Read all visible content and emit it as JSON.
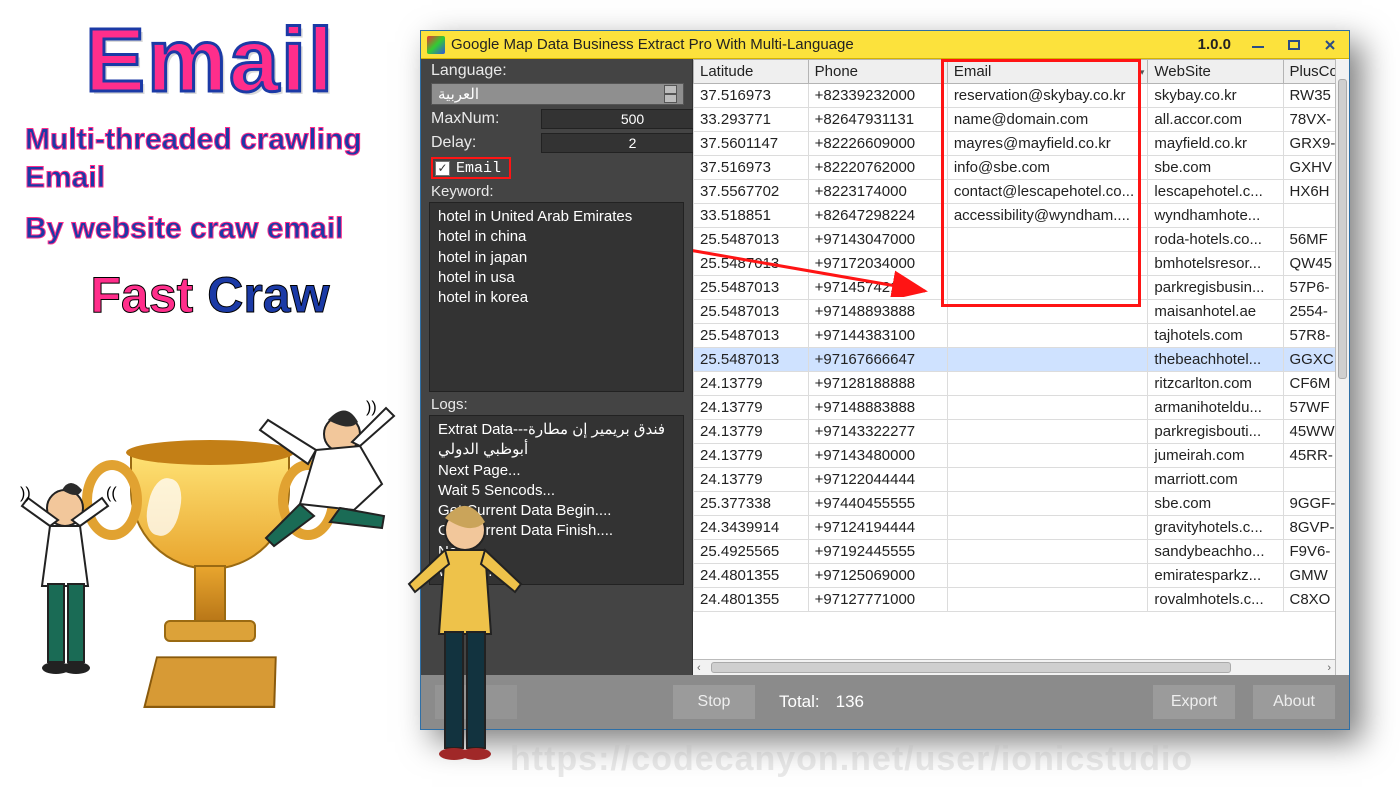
{
  "promo": {
    "headline": "Email",
    "line1": "Multi-threaded crawling Email",
    "line2": "By website craw email",
    "fast1": "Fast",
    "fast2": "Craw"
  },
  "watermark": "https://codecanyon.net/user/ionicstudio",
  "window": {
    "title": "Google Map Data Business Extract Pro With Multi-Language",
    "version": "1.0.0"
  },
  "sidebar": {
    "language_label": "Language:",
    "language_value": "العربية",
    "maxnum_label": "MaxNum:",
    "maxnum_value": "500",
    "delay_label": "Delay:",
    "delay_value": "2",
    "email_checkbox_label": "Email",
    "email_checked": true,
    "keyword_label": "Keyword:",
    "keywords": [
      "hotel in United Arab Emirates",
      "hotel in china",
      "hotel in japan",
      "hotel in usa",
      "hotel in korea"
    ],
    "logs_label": "Logs:",
    "logs": [
      "Extrat Data---فندق بريمير إن مطارة أبوظبي الدولي",
      "Next Page...",
      "Wait 5 Sencods...",
      "Get Current Data Begin....",
      "Get Current Data Finish....",
      "Next ...",
      "Wa...     s...",
      "Fini..."
    ]
  },
  "table": {
    "headers": {
      "lat": "Latitude",
      "phone": "Phone",
      "email": "Email",
      "web": "WebSite",
      "plus": "PlusCo"
    },
    "selected_index": 12,
    "rows": [
      {
        "lat": "37.516973",
        "phone": "+82339232000",
        "email": "reservation@skybay.co.kr",
        "web": "skybay.co.kr",
        "plus": "RW35"
      },
      {
        "lat": "33.293771",
        "phone": "+82647931131",
        "email": "name@domain.com",
        "web": "all.accor.com",
        "plus": "78VX-"
      },
      {
        "lat": "37.5601147",
        "phone": "+82226609000",
        "email": "mayres@mayfield.co.kr",
        "web": "mayfield.co.kr",
        "plus": "GRX9-"
      },
      {
        "lat": "37.516973",
        "phone": "+82220762000",
        "email": "info@sbe.com",
        "web": "sbe.com",
        "plus": "GXHV"
      },
      {
        "lat": "37.5567702",
        "phone": "+8223174000",
        "email": "contact@lescapehotel.co...",
        "web": "lescapehotel.c...",
        "plus": "HX6H"
      },
      {
        "lat": "33.518851",
        "phone": "+82647298224",
        "email": "accessibility@wyndham....",
        "web": "wyndhamhote...",
        "plus": ""
      },
      {
        "lat": "25.5487013",
        "phone": "+97143047000",
        "email": "",
        "web": "roda-hotels.co...",
        "plus": "56MF"
      },
      {
        "lat": "25.5487013",
        "phone": "+97172034000",
        "email": "",
        "web": "bmhotelsresor...",
        "plus": "QW45"
      },
      {
        "lat": "25.5487013",
        "phone": "+97145742100",
        "email": "",
        "web": "parkregisbusin...",
        "plus": "57P6-"
      },
      {
        "lat": "25.5487013",
        "phone": "+97148893888",
        "email": "",
        "web": "maisanhotel.ae",
        "plus": "2554-"
      },
      {
        "lat": "25.5487013",
        "phone": "+97144383100",
        "email": "",
        "web": "tajhotels.com",
        "plus": "57R8-"
      },
      {
        "lat": "25.5487013",
        "phone": "+97167666647",
        "email": "",
        "web": "thebeachhotel...",
        "plus": "GGXC"
      },
      {
        "lat": "24.13779",
        "phone": "+97128188888",
        "email": "",
        "web": "ritzcarlton.com",
        "plus": "CF6M"
      },
      {
        "lat": "24.13779",
        "phone": "+97148883888",
        "email": "",
        "web": "armanihoteldu...",
        "plus": "57WF"
      },
      {
        "lat": "24.13779",
        "phone": "+97143322277",
        "email": "",
        "web": "parkregisbouti...",
        "plus": "45WW"
      },
      {
        "lat": "24.13779",
        "phone": "+97143480000",
        "email": "",
        "web": "jumeirah.com",
        "plus": "45RR-"
      },
      {
        "lat": "24.13779",
        "phone": "+97122044444",
        "email": "",
        "web": "marriott.com",
        "plus": ""
      },
      {
        "lat": "25.377338",
        "phone": "+97440455555",
        "email": "",
        "web": "sbe.com",
        "plus": "9GGF-"
      },
      {
        "lat": "24.3439914",
        "phone": "+97124194444",
        "email": "",
        "web": "gravityhotels.c...",
        "plus": "8GVP-"
      },
      {
        "lat": "25.4925565",
        "phone": "+97192445555",
        "email": "",
        "web": "sandybeachho...",
        "plus": "F9V6-"
      },
      {
        "lat": "24.4801355",
        "phone": "+97125069000",
        "email": "",
        "web": "emiratesparkz...",
        "plus": "GMW"
      },
      {
        "lat": "24.4801355",
        "phone": "+97127771000",
        "email": "",
        "web": "rovalmhotels.c...",
        "plus": "C8XO"
      }
    ]
  },
  "footer": {
    "stop": "Stop",
    "export": "Export",
    "about": "About",
    "total_label": "Total:",
    "total_value": "136"
  }
}
